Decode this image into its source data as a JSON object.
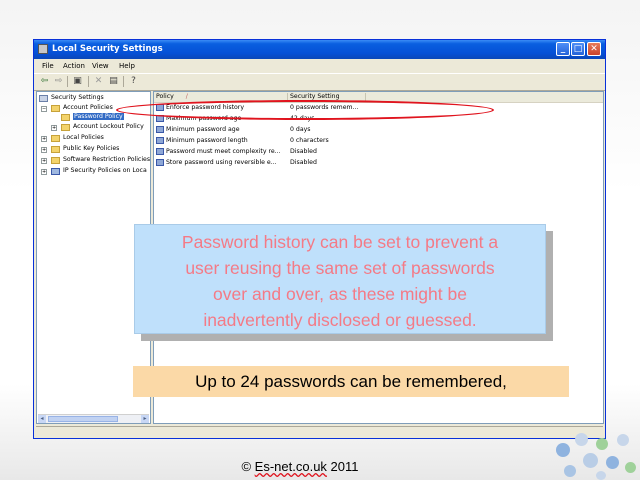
{
  "window": {
    "title": "Local Security Settings",
    "controls": {
      "minimize": "_",
      "maximize": "□",
      "close": "✕"
    }
  },
  "menu": [
    "File",
    "Action",
    "View",
    "Help"
  ],
  "tree": {
    "root": "Security Settings",
    "account_policies": "Account Policies",
    "password_policy": "Password Policy",
    "account_lockout": "Account Lockout Policy",
    "local_policies": "Local Policies",
    "public_key": "Public Key Policies",
    "software_restriction": "Software Restriction Policies",
    "ip_security": "IP Security Policies on Loca"
  },
  "table": {
    "columns": [
      "Policy",
      "Security Setting"
    ],
    "sort_indicator": "/",
    "rows": [
      {
        "policy": "Enforce password history",
        "setting": "0 passwords remem..."
      },
      {
        "policy": "Maximum password age",
        "setting": "42 days"
      },
      {
        "policy": "Minimum password age",
        "setting": "0 days"
      },
      {
        "policy": "Minimum password length",
        "setting": "0 characters"
      },
      {
        "policy": "Password must meet complexity re...",
        "setting": "Disabled"
      },
      {
        "policy": "Store password using reversible e...",
        "setting": "Disabled"
      }
    ]
  },
  "callout": {
    "lines": [
      "Password history can be set to prevent a",
      "user reusing the same set of passwords",
      "over and over, as these might be",
      "inadvertently disclosed or guessed."
    ],
    "color": "#f47a86",
    "background": "#bfe0fb"
  },
  "note": {
    "text": "Up to 24 passwords can be remembered,",
    "background": "#fbd9a7"
  },
  "footer": {
    "prefix": "© ",
    "domain": "Es-net.co.uk",
    "year": " 2011"
  },
  "icons": {
    "back": "back-arrow-icon",
    "forward": "forward-arrow-icon",
    "up": "up-folder-icon",
    "delete": "delete-icon",
    "export": "export-list-icon",
    "help": "help-icon"
  }
}
